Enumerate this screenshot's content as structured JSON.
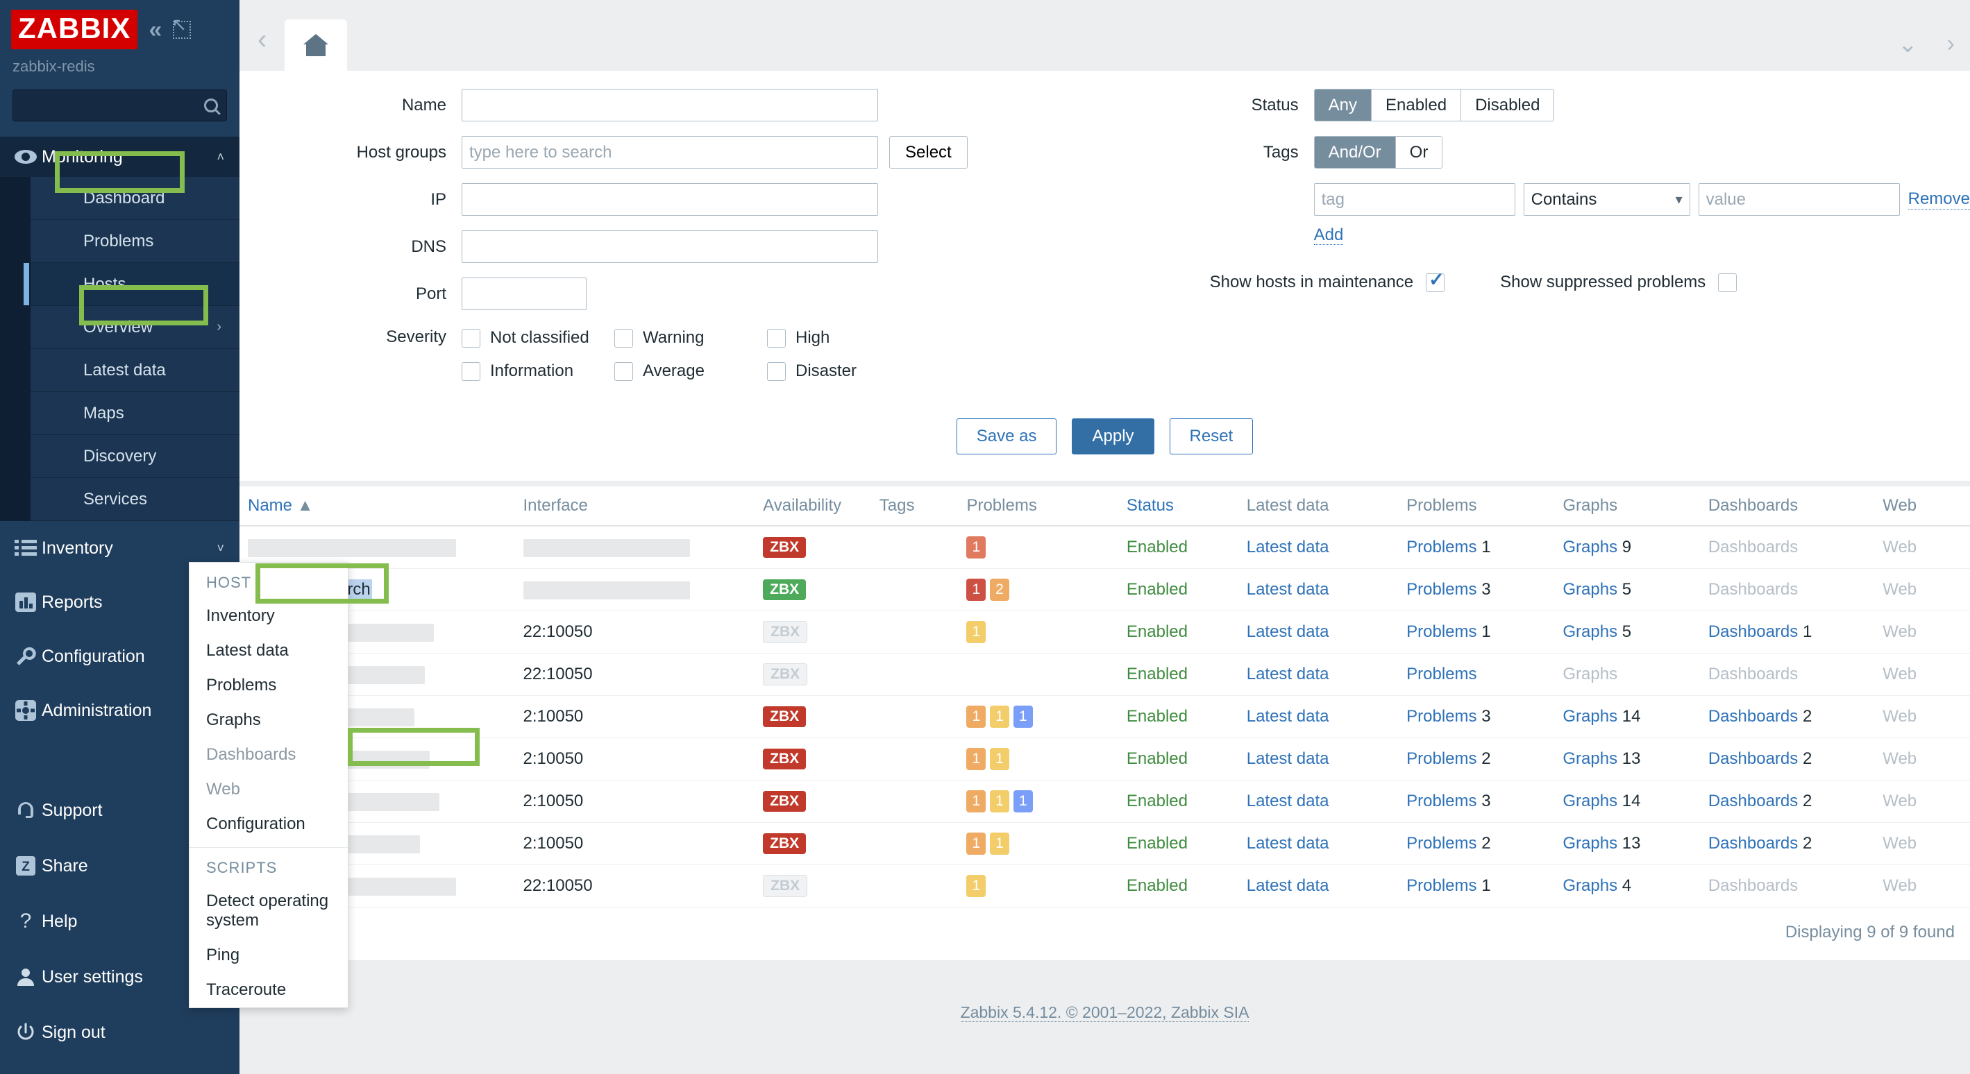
{
  "sidebar": {
    "logo": "ZABBIX",
    "server_name": "zabbix-redis",
    "collapse_icon": "double-chevron-left-icon",
    "expand_icon": "expand-arrow-icon",
    "groups": [
      {
        "label": "Monitoring",
        "icon": "eye-icon",
        "caret": "˄",
        "open": true,
        "items": [
          "Dashboard",
          "Problems",
          "Hosts",
          "Overview",
          "Latest data",
          "Maps",
          "Discovery",
          "Services"
        ],
        "active_item": "Hosts"
      },
      {
        "label": "Inventory",
        "icon": "list-icon",
        "caret": "˅",
        "open": false,
        "items": []
      },
      {
        "label": "Reports",
        "icon": "bar-chart-icon",
        "caret": "˅",
        "open": false,
        "items": []
      },
      {
        "label": "Configuration",
        "icon": "wrench-icon",
        "caret": "˅",
        "open": false,
        "items": []
      },
      {
        "label": "Administration",
        "icon": "gear-icon",
        "caret": "˅",
        "open": false,
        "items": []
      }
    ],
    "bottom": [
      {
        "label": "Support",
        "icon": "headset-icon"
      },
      {
        "label": "Share",
        "icon": "zabbix-z-icon"
      },
      {
        "label": "Help",
        "icon": "question-mark-icon"
      },
      {
        "label": "User settings",
        "icon": "user-icon",
        "caret": "˅"
      },
      {
        "label": "Sign out",
        "icon": "power-icon"
      }
    ]
  },
  "tabbar": {
    "back_icon": "chevron-left-icon",
    "home_icon": "home-icon",
    "collapse_icon": "chevron-down-icon",
    "next_icon": "chevron-right-icon"
  },
  "filter": {
    "name_label": "Name",
    "name_value": "",
    "hostgroups_label": "Host groups",
    "hostgroups_placeholder": "type here to search",
    "select_button": "Select",
    "ip_label": "IP",
    "ip_value": "",
    "dns_label": "DNS",
    "dns_value": "",
    "port_label": "Port",
    "port_value": "",
    "severity_label": "Severity",
    "severities": [
      {
        "label": "Not classified",
        "checked": false
      },
      {
        "label": "Information",
        "checked": false
      },
      {
        "label": "Warning",
        "checked": false
      },
      {
        "label": "Average",
        "checked": false
      },
      {
        "label": "High",
        "checked": false
      },
      {
        "label": "Disaster",
        "checked": false
      }
    ],
    "status_label": "Status",
    "status_options": [
      "Any",
      "Enabled",
      "Disabled"
    ],
    "status_selected": "Any",
    "tags_label": "Tags",
    "tags_options": [
      "And/Or",
      "Or"
    ],
    "tags_selected": "And/Or",
    "tag_placeholder": "tag",
    "tag_operator": "Contains",
    "tag_value_placeholder": "value",
    "remove_link": "Remove",
    "add_link": "Add",
    "maintenance_label": "Show hosts in maintenance",
    "maintenance_checked": true,
    "suppressed_label": "Show suppressed problems",
    "suppressed_checked": false,
    "save_as_button": "Save as",
    "apply_button": "Apply",
    "reset_button": "Reset"
  },
  "table": {
    "columns": [
      "Name",
      "Interface",
      "Availability",
      "Tags",
      "Problems",
      "Status",
      "Latest data",
      "Problems",
      "Graphs",
      "Dashboards",
      "Web"
    ],
    "sort_column": "Name",
    "sort_dir": "asc",
    "rows": [
      {
        "name": "",
        "redacted": true,
        "interface": "",
        "interface_redacted": true,
        "zbx": "red",
        "problems": [
          {
            "n": "1",
            "sev": "high"
          }
        ],
        "status": "Enabled",
        "latest": "Latest data",
        "prob_link": "Problems",
        "prob_count": "1",
        "graphs": "Graphs",
        "graphs_count": "9",
        "dash": "Dashboards",
        "dash_count": "",
        "web": "Web",
        "dash_enabled": false,
        "graphs_enabled": true
      },
      {
        "name": "My-OpenSearch",
        "redacted": false,
        "selected": true,
        "interface": "",
        "interface_redacted": true,
        "zbx": "green",
        "problems": [
          {
            "n": "1",
            "sev": "disaster"
          },
          {
            "n": "2",
            "sev": "average"
          }
        ],
        "status": "Enabled",
        "latest": "Latest data",
        "prob_link": "Problems",
        "prob_count": "3",
        "graphs": "Graphs",
        "graphs_count": "5",
        "dash": "Dashboards",
        "dash_count": "",
        "web": "Web",
        "dash_enabled": false,
        "graphs_enabled": true
      },
      {
        "name": "",
        "redacted": true,
        "interface": "22:10050",
        "interface_partial": true,
        "zbx": "gray",
        "problems": [
          {
            "n": "1",
            "sev": "warning"
          }
        ],
        "status": "Enabled",
        "latest": "Latest data",
        "prob_link": "Problems",
        "prob_count": "1",
        "graphs": "Graphs",
        "graphs_count": "5",
        "dash": "Dashboards",
        "dash_count": "1",
        "web": "Web",
        "dash_enabled": true,
        "graphs_enabled": true
      },
      {
        "name": "",
        "redacted": true,
        "interface": "22:10050",
        "interface_partial": true,
        "zbx": "gray",
        "problems": [],
        "status": "Enabled",
        "latest": "Latest data",
        "prob_link": "Problems",
        "prob_count": "",
        "graphs": "Graphs",
        "graphs_count": "",
        "dash": "Dashboards",
        "dash_count": "",
        "web": "Web",
        "dash_enabled": false,
        "graphs_enabled": false
      },
      {
        "name": "",
        "redacted": true,
        "interface": "2:10050",
        "interface_partial": true,
        "zbx": "red",
        "problems": [
          {
            "n": "1",
            "sev": "average"
          },
          {
            "n": "1",
            "sev": "warning"
          },
          {
            "n": "1",
            "sev": "info"
          }
        ],
        "status": "Enabled",
        "latest": "Latest data",
        "prob_link": "Problems",
        "prob_count": "3",
        "graphs": "Graphs",
        "graphs_count": "14",
        "dash": "Dashboards",
        "dash_count": "2",
        "web": "Web",
        "dash_enabled": true,
        "graphs_enabled": true
      },
      {
        "name": "",
        "redacted": true,
        "interface": "2:10050",
        "interface_partial": true,
        "zbx": "red",
        "problems": [
          {
            "n": "1",
            "sev": "average"
          },
          {
            "n": "1",
            "sev": "warning"
          }
        ],
        "status": "Enabled",
        "latest": "Latest data",
        "prob_link": "Problems",
        "prob_count": "2",
        "graphs": "Graphs",
        "graphs_count": "13",
        "dash": "Dashboards",
        "dash_count": "2",
        "web": "Web",
        "dash_enabled": true,
        "graphs_enabled": true
      },
      {
        "name": "",
        "redacted": true,
        "interface": "2:10050",
        "interface_partial": true,
        "zbx": "red",
        "problems": [
          {
            "n": "1",
            "sev": "average"
          },
          {
            "n": "1",
            "sev": "warning"
          },
          {
            "n": "1",
            "sev": "info"
          }
        ],
        "status": "Enabled",
        "latest": "Latest data",
        "prob_link": "Problems",
        "prob_count": "3",
        "graphs": "Graphs",
        "graphs_count": "14",
        "dash": "Dashboards",
        "dash_count": "2",
        "web": "Web",
        "dash_enabled": true,
        "graphs_enabled": true
      },
      {
        "name": "",
        "redacted": true,
        "interface": "2:10050",
        "interface_partial": true,
        "zbx": "red",
        "problems": [
          {
            "n": "1",
            "sev": "average"
          },
          {
            "n": "1",
            "sev": "warning"
          }
        ],
        "status": "Enabled",
        "latest": "Latest data",
        "prob_link": "Problems",
        "prob_count": "2",
        "graphs": "Graphs",
        "graphs_count": "13",
        "dash": "Dashboards",
        "dash_count": "2",
        "web": "Web",
        "dash_enabled": true,
        "graphs_enabled": true
      },
      {
        "name": "",
        "redacted": true,
        "interface": "22:10050",
        "interface_partial": true,
        "zbx": "gray",
        "problems": [
          {
            "n": "1",
            "sev": "warning"
          }
        ],
        "status": "Enabled",
        "latest": "Latest data",
        "prob_link": "Problems",
        "prob_count": "1",
        "graphs": "Graphs",
        "graphs_count": "4",
        "dash": "Dashboards",
        "dash_count": "",
        "web": "Web",
        "dash_enabled": false,
        "graphs_enabled": true
      }
    ],
    "displaying": "Displaying 9 of 9 found"
  },
  "context_menu": {
    "host_header": "HOST",
    "host_items": [
      {
        "label": "Inventory",
        "disabled": false
      },
      {
        "label": "Latest data",
        "disabled": false
      },
      {
        "label": "Problems",
        "disabled": false
      },
      {
        "label": "Graphs",
        "disabled": false,
        "highlighted": true
      },
      {
        "label": "Dashboards",
        "disabled": true
      },
      {
        "label": "Web",
        "disabled": true
      },
      {
        "label": "Configuration",
        "disabled": false
      }
    ],
    "scripts_header": "SCRIPTS",
    "scripts_items": [
      {
        "label": "Detect operating system"
      },
      {
        "label": "Ping"
      },
      {
        "label": "Traceroute"
      }
    ]
  },
  "footer": {
    "text": "Zabbix 5.4.12. © 2001–2022, Zabbix SIA"
  },
  "colors": {
    "brand_red": "#d40000",
    "sidebar_bg": "#1f3d5c",
    "accent_blue": "#2e72b8",
    "highlight_green": "#84bd4e",
    "enabled_green": "#3f8c3f"
  }
}
